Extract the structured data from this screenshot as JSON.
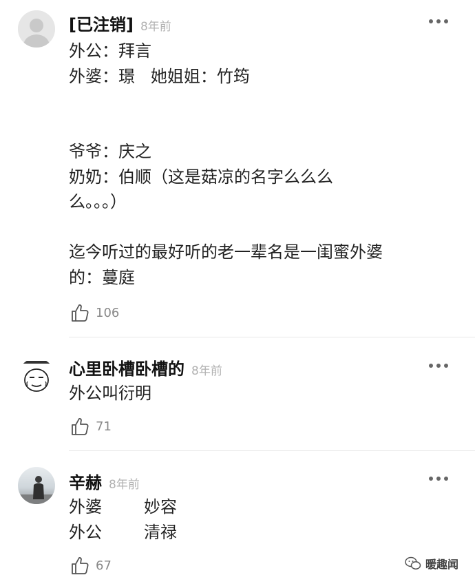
{
  "comments": [
    {
      "username": "[已注销]",
      "time": "8年前",
      "lines": [
        "外公：拜言",
        "外婆：璟   她姐姐：竹筠",
        "",
        "",
        "爷爷：庆之",
        "奶奶：伯顺（这是菇凉的名字么么么",
        "么。。。）",
        "",
        "迄今听过的最好听的老一辈名是一闺蜜外婆",
        "的：蔓庭"
      ],
      "likes": "106"
    },
    {
      "username": "心里卧槽卧槽的",
      "time": "8年前",
      "lines": [
        "外公叫衍明"
      ],
      "likes": "71"
    },
    {
      "username": "辛赫",
      "time": "8年前",
      "lines": [
        "外婆        妙容",
        "外公        清禄"
      ],
      "likes": "67"
    }
  ],
  "watermark": {
    "text": "暖趣闻"
  }
}
